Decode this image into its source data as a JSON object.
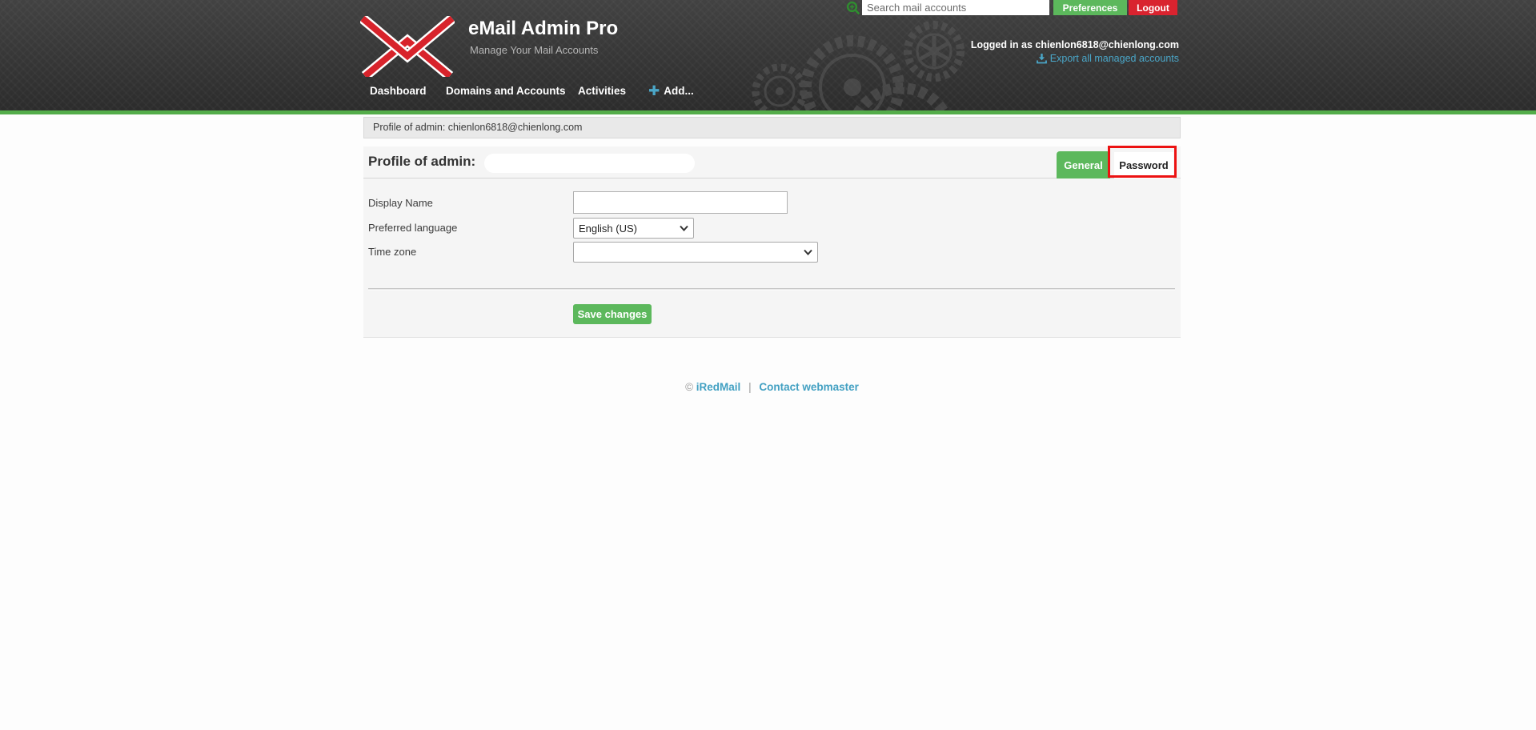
{
  "topbar": {
    "search_placeholder": "Search mail accounts",
    "preferences_label": "Preferences",
    "logout_label": "Logout"
  },
  "header": {
    "title": "eMail Admin Pro",
    "subtitle": "Manage Your Mail Accounts",
    "logged_in_text": "Logged in as chienlon6818@chienlong.com",
    "export_label": "Export all managed accounts",
    "nav": [
      {
        "label": "Dashboard"
      },
      {
        "label": "Domains and Accounts"
      },
      {
        "label": "Activities"
      },
      {
        "label": "Add..."
      }
    ]
  },
  "breadcrumb": {
    "text": "Profile of admin: chienlon6818@chienlong.com"
  },
  "main": {
    "page_title": "Profile of admin:",
    "tabs": [
      {
        "label": "General",
        "active": true
      },
      {
        "label": "Password",
        "active": false,
        "highlighted": true
      }
    ],
    "form": {
      "fields": [
        {
          "label": "Display Name",
          "type": "text",
          "value": "",
          "placeholder": ""
        },
        {
          "label": "Preferred language",
          "type": "select",
          "value": "English (US)"
        },
        {
          "label": "Time zone",
          "type": "select",
          "value": ""
        }
      ],
      "save_label": "Save changes"
    }
  },
  "footer": {
    "copyright": "©",
    "brand": "iRedMail",
    "separator": "|",
    "contact": "Contact webmaster"
  },
  "icons": {
    "search": "search-zoom-icon",
    "export": "download-icon",
    "add": "plus-icon",
    "selects": "chevron-down-icon"
  },
  "colors": {
    "accent_green": "#5cb85c",
    "logout_red": "#d9232f",
    "header_line_green": "#54ad4a",
    "link_blue": "#45a3c4",
    "annotation_red": "#ec1212",
    "logo_red": "#d8232b",
    "card_bg": "#f5f5f5",
    "header_bg": "#333333"
  }
}
